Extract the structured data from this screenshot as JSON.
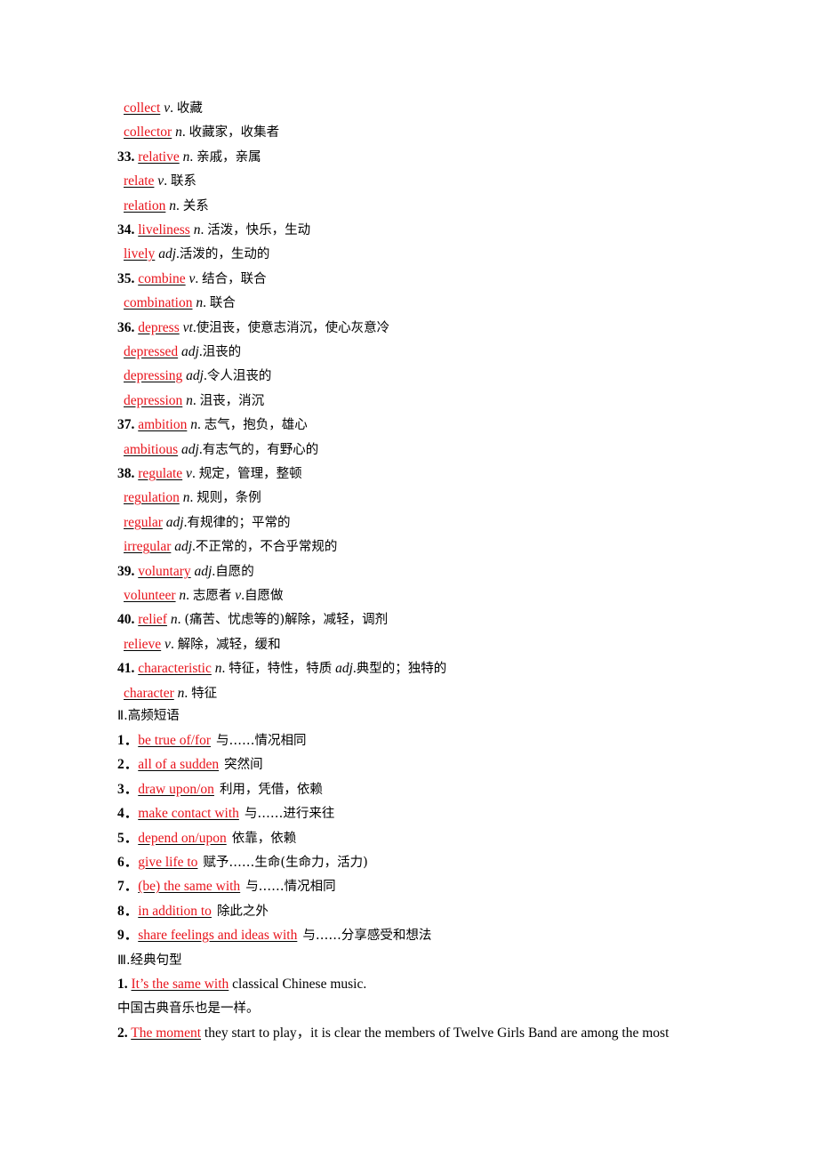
{
  "vocabulary_entries": [
    {
      "num": "",
      "word": "collect",
      "pos": "v",
      "sep": ". ",
      "meaning": "收藏"
    },
    {
      "num": "",
      "word": "collector",
      "pos": "n",
      "sep": ". ",
      "meaning": "收藏家，收集者"
    },
    {
      "num": "33.",
      "word": "relative",
      "pos": "n",
      "sep": ". ",
      "meaning": "亲戚，亲属"
    },
    {
      "num": "",
      "word": "relate",
      "pos": "v",
      "sep": ". ",
      "meaning": "联系"
    },
    {
      "num": "",
      "word": "relation",
      "pos": "n",
      "sep": ". ",
      "meaning": "关系"
    },
    {
      "num": "34.",
      "word": "liveliness",
      "pos": "n",
      "sep": ". ",
      "meaning": "活泼，快乐，生动"
    },
    {
      "num": "",
      "word": "lively",
      "pos": "adj",
      "sep": ".",
      "meaning": "活泼的，生动的"
    },
    {
      "num": "35.",
      "word": "combine",
      "pos": "v",
      "sep": ". ",
      "meaning": "结合，联合"
    },
    {
      "num": "",
      "word": "combination",
      "pos": "n",
      "sep": ". ",
      "meaning": "联合"
    },
    {
      "num": "36.",
      "word": "depress",
      "pos": "vt",
      "sep": ".",
      "meaning": "使沮丧，使意志消沉，使心灰意冷"
    },
    {
      "num": "",
      "word": "depressed",
      "pos": "adj",
      "sep": ".",
      "meaning": "沮丧的"
    },
    {
      "num": "",
      "word": "depressing",
      "pos": "adj",
      "sep": ".",
      "meaning": "令人沮丧的"
    },
    {
      "num": "",
      "word": "depression",
      "pos": "n",
      "sep": ". ",
      "meaning": "沮丧，消沉"
    },
    {
      "num": "37.",
      "word": "ambition",
      "pos": "n",
      "sep": ". ",
      "meaning": "志气，抱负，雄心"
    },
    {
      "num": "",
      "word": "ambitious",
      "pos": "adj",
      "sep": ".",
      "meaning": "有志气的，有野心的"
    },
    {
      "num": "38.",
      "word": "regulate",
      "pos": "v",
      "sep": ". ",
      "meaning": "规定，管理，整顿"
    },
    {
      "num": "",
      "word": "regulation",
      "pos": "n",
      "sep": ". ",
      "meaning": "规则，条例"
    },
    {
      "num": "",
      "word": "regular",
      "pos": "adj",
      "sep": ".",
      "meaning": "有规律的；平常的"
    },
    {
      "num": "",
      "word": "irregular",
      "pos": "adj",
      "sep": ".",
      "meaning": "不正常的，不合乎常规的"
    },
    {
      "num": "39.",
      "word": "voluntary",
      "pos": "adj",
      "sep": ".",
      "meaning": "自愿的"
    },
    {
      "num": "",
      "word": "volunteer",
      "pos": "n",
      "sep": ". ",
      "meaning": "志愿者",
      "pos2": "v",
      "meaning2": "自愿做"
    },
    {
      "num": "40.",
      "word": "relief",
      "pos": "n",
      "sep": ". ",
      "meaning": "(痛苦、忧虑等的)解除，减轻，调剂"
    },
    {
      "num": "",
      "word": "relieve",
      "pos": "v",
      "sep": ". ",
      "meaning": "解除，减轻，缓和"
    },
    {
      "num": "41.",
      "word": "characteristic",
      "pos": "n",
      "sep": ". ",
      "meaning": "特征，特性，特质",
      "pos2": "adj",
      "meaning2": "典型的；独特的"
    },
    {
      "num": "",
      "word": "character",
      "pos": "n",
      "sep": ". ",
      "meaning": "特征"
    }
  ],
  "section2": {
    "heading": "Ⅱ.高频短语",
    "phrases": [
      {
        "num": "1．",
        "phrase": "be true of/for",
        "meaning": "与……情况相同"
      },
      {
        "num": "2．",
        "phrase": "all of a sudden",
        "meaning": "突然间"
      },
      {
        "num": "3．",
        "phrase": "draw upon/on",
        "meaning": "利用，凭借，依赖"
      },
      {
        "num": "4．",
        "phrase": "make contact with",
        "meaning": "与……进行来往"
      },
      {
        "num": "5．",
        "phrase": "depend on/upon",
        "meaning": "依靠，依赖"
      },
      {
        "num": "6．",
        "phrase": "give life to",
        "meaning": "赋予……生命(生命力，活力)"
      },
      {
        "num": "7．",
        "phrase": "(be) the same with",
        "meaning": "与……情况相同"
      },
      {
        "num": "8．",
        "phrase": "in addition to",
        "meaning": "除此之外"
      },
      {
        "num": "9．",
        "phrase": "share feelings and ideas with",
        "meaning": "与……分享感受和想法"
      }
    ]
  },
  "section3": {
    "heading": "Ⅲ.经典句型",
    "sentences": [
      {
        "num": "1.",
        "answer": "It’s the same with",
        "rest": " classical Chinese music.",
        "translation": "中国古典音乐也是一样。"
      },
      {
        "num": "2.",
        "answer": "The moment",
        "rest": " they start to play，it is clear the members of Twelve Girls Band are among the most"
      }
    ]
  },
  "colors": {
    "answer": "#e8141c",
    "text": "#000000",
    "underline": "#000000"
  }
}
